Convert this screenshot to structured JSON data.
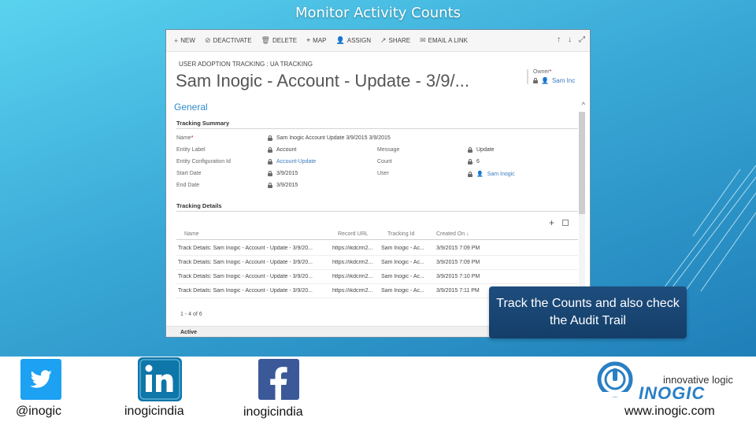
{
  "slide": {
    "title": "Monitor Activity Counts",
    "callout": "Track the Counts and also check the Audit Trail"
  },
  "crm": {
    "commands": [
      {
        "icon": "+",
        "label": "NEW",
        "name": "new-button"
      },
      {
        "icon": "⊘",
        "label": "DEACTIVATE",
        "name": "deactivate-button"
      },
      {
        "icon": "🗑",
        "label": "DELETE",
        "name": "delete-button"
      },
      {
        "icon": "⌖",
        "label": "MAP",
        "name": "map-button"
      },
      {
        "icon": "👤",
        "label": "ASSIGN",
        "name": "assign-button"
      },
      {
        "icon": "↗",
        "label": "SHARE",
        "name": "share-button"
      },
      {
        "icon": "✉",
        "label": "EMAIL A LINK",
        "name": "email-link-button"
      }
    ],
    "breadcrumb": "USER ADOPTION TRACKING : UA TRACKING",
    "record_title": "Sam Inogic - Account - Update - 3/9/...",
    "owner": {
      "label": "Owner",
      "value": "Sam Inc"
    },
    "section": "General",
    "tracking_summary": {
      "header": "Tracking Summary",
      "name_label": "Name",
      "name_value": "Sam Inogic   Account   Update   3/9/2015   3/9/2015",
      "entity_label_label": "Entity Label",
      "entity_label_value": "Account",
      "entity_config_label": "Entity Configuration Id",
      "entity_config_value": "Account-Update",
      "start_date_label": "Start Date",
      "start_date_value": "3/9/2015",
      "end_date_label": "End Date",
      "end_date_value": "3/9/2015",
      "message_label": "Message",
      "message_value": "Update",
      "count_label": "Count",
      "count_value": "6",
      "user_label": "User",
      "user_value": "Sam Inogic"
    },
    "tracking_details": {
      "header": "Tracking Details",
      "columns": [
        "Name",
        "Record URL",
        "Tracking Id",
        "Created On ↓"
      ],
      "rows": [
        [
          "Track Details: Sam Inogic - Account - Update - 3/9/20...",
          "https://ikdcrm2...",
          "Sam Inogic - Ac...",
          "3/9/2015 7:09 PM"
        ],
        [
          "Track Details: Sam Inogic - Account - Update - 3/9/20...",
          "https://ikdcrm2...",
          "Sam Inogic - Ac...",
          "3/9/2015 7:09 PM"
        ],
        [
          "Track Details: Sam Inogic - Account - Update - 3/9/20...",
          "https://ikdcrm2...",
          "Sam Inogic - Ac...",
          "3/9/2015 7:10 PM"
        ],
        [
          "Track Details: Sam Inogic - Account - Update - 3/9/20...",
          "https://ikdcrm2...",
          "Sam Inogic - Ac...",
          "3/9/2015 7:11 PM"
        ]
      ],
      "paging": "1 - 4 of 6"
    },
    "status": "Active"
  },
  "social": {
    "twitter": "@inogic",
    "linkedin": "inogicindia",
    "facebook": "inogicindia",
    "logo_tagline": "innovative logic",
    "logo_name": "INOGIC",
    "website": "www.inogic.com"
  },
  "colors": {
    "slide_top": "#5ad3ef",
    "slide_bottom": "#1f7fb8",
    "callout": "#143e69",
    "link": "#3a7bbf",
    "section": "#2f8bc9",
    "twitter": "#1da1f2",
    "linkedin": "#0e76a8",
    "facebook": "#3b5998"
  }
}
